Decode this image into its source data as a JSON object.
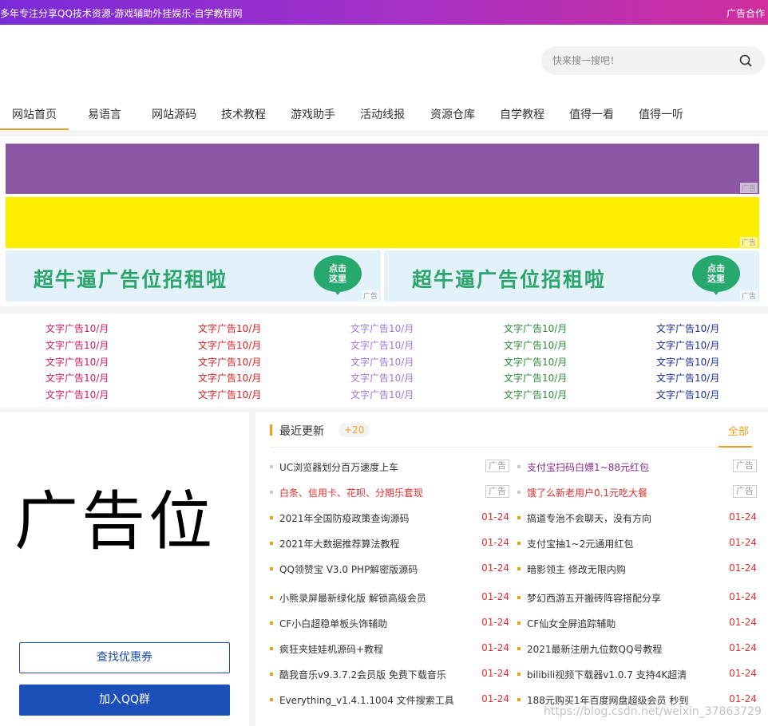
{
  "topbar": {
    "title": "多年专注分享QQ技术资源-游戏辅助外挂娱乐-自学教程网",
    "ad_coop": "广告合作"
  },
  "search": {
    "placeholder": "快来搜一搜吧！"
  },
  "nav": {
    "items": [
      "网站首页",
      "易语言",
      "网站源码",
      "技术教程",
      "游戏助手",
      "活动线报",
      "资源仓库",
      "自学教程",
      "值得一看",
      "值得一听"
    ]
  },
  "banners": {
    "ad_tag": "广告",
    "recruit_text": "超牛逼广告位招租啦",
    "bubble_line1": "点击",
    "bubble_line2": "这里"
  },
  "text_ads": {
    "label": "文字广告10/月",
    "columns": [
      {
        "color": "#cc1a63",
        "rows": 5
      },
      {
        "color": "#d81e1e",
        "rows": 5
      },
      {
        "color": "#9a7ad8",
        "rows": 5
      },
      {
        "color": "#2e8a3c",
        "rows": 5
      },
      {
        "color": "#1a2b9a",
        "rows": 5
      }
    ]
  },
  "left": {
    "big_ad": "广告位",
    "coupon_btn": "查找优惠券",
    "qq_btn": "加入QQ群"
  },
  "recent": {
    "title": "最近更新",
    "count": "+20",
    "all": "全部",
    "left_list": [
      {
        "title": "UC浏览器划分百万速度上车",
        "date": "广告",
        "ad": true,
        "color": "#333",
        "dot": "gray"
      },
      {
        "title": "白条、信用卡、花呗、分期乐套现",
        "date": "广告",
        "ad": true,
        "color": "#e03030",
        "dot": "gray"
      },
      {
        "title": "2021年全国防疫政策查询源码",
        "date": "01-24",
        "ad": false,
        "color": "#333",
        "dot": "orange"
      },
      {
        "title": "2021年大数据推荐算法教程",
        "date": "01-24",
        "ad": false,
        "color": "#333",
        "dot": "orange"
      },
      {
        "title": "QQ领赞宝 V3.0 PHP解密版源码",
        "date": "01-24",
        "ad": false,
        "color": "#333",
        "dot": "orange"
      },
      {
        "title": "小熊录屏最新绿化版 解锁高级会员",
        "date": "01-24",
        "ad": false,
        "color": "#333",
        "dot": "orange"
      },
      {
        "title": "CF小白超稳单板头饰辅助",
        "date": "01-24",
        "ad": false,
        "color": "#333",
        "dot": "orange"
      },
      {
        "title": "疯狂夹娃娃机源码+教程",
        "date": "01-24",
        "ad": false,
        "color": "#333",
        "dot": "orange"
      },
      {
        "title": "酷我音乐v9.3.7.2会员版 免费下载音乐",
        "date": "01-24",
        "ad": false,
        "color": "#333",
        "dot": "orange"
      },
      {
        "title": "Everything_v1.4.1.1004 文件搜索工具",
        "date": "01-24",
        "ad": false,
        "color": "#333",
        "dot": "orange"
      }
    ],
    "right_list": [
      {
        "title": "支付宝扫码白嫖1~88元红包",
        "date": "广告",
        "ad": true,
        "color": "#8b2a8a",
        "dot": "gray"
      },
      {
        "title": "饿了么新老用户0.1元吃大餐",
        "date": "广告",
        "ad": true,
        "color": "#e03030",
        "dot": "gray"
      },
      {
        "title": "搞道专治不会聊天，没有方向",
        "date": "01-24",
        "ad": false,
        "color": "#333",
        "dot": "orange"
      },
      {
        "title": "支付宝抽1~2元通用红包",
        "date": "01-24",
        "ad": false,
        "color": "#333",
        "dot": "orange"
      },
      {
        "title": "暗影领主 修改无限内购",
        "date": "01-24",
        "ad": false,
        "color": "#333",
        "dot": "orange"
      },
      {
        "title": "梦幻西游五开搬砖阵容搭配分享",
        "date": "01-24",
        "ad": false,
        "color": "#333",
        "dot": "orange"
      },
      {
        "title": "CF仙女全屏追踪辅助",
        "date": "01-24",
        "ad": false,
        "color": "#333",
        "dot": "orange"
      },
      {
        "title": "2021最新注册九位数QQ号教程",
        "date": "01-24",
        "ad": false,
        "color": "#333",
        "dot": "orange"
      },
      {
        "title": "bilibili视频下载器v1.0.7 支持4K超清",
        "date": "01-24",
        "ad": false,
        "color": "#333",
        "dot": "orange"
      },
      {
        "title": "188元购买1年百度网盘超级会员 秒到",
        "date": "01-24",
        "ad": false,
        "color": "#333",
        "dot": "orange"
      }
    ]
  },
  "watermark": "https://blog.csdn.net/weixin_37863729"
}
